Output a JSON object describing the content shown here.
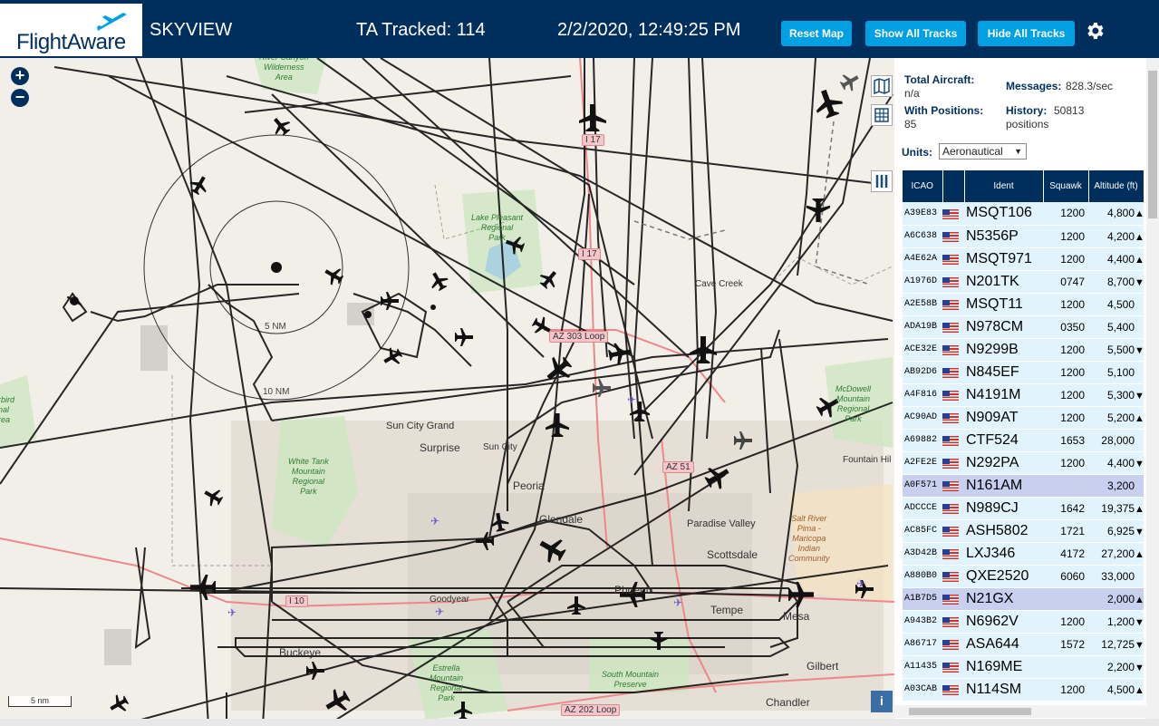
{
  "header": {
    "logo_text": "FlightAware",
    "site_name": "SKYVIEW",
    "tracked": "TA Tracked: 114",
    "datetime": "2/2/2020, 12:49:25 PM",
    "buttons": {
      "reset": "Reset Map",
      "show_all": "Show All Tracks",
      "hide_all": "Hide All Tracks"
    },
    "brand_color": "#002f5d",
    "button_color": "#00a0e2"
  },
  "map": {
    "zoom_in": "+",
    "zoom_out": "−",
    "scale_label": "5 nm",
    "ring_labels": [
      "5 NM",
      "10 NM"
    ],
    "info_icon": "i",
    "places": [
      "Cave Creek",
      "Sun City Grand",
      "Surprise",
      "Sun City",
      "Peoria",
      "Glendale",
      "Paradise Valley",
      "Scottsdale",
      "Phoenix",
      "Tempe",
      "Mesa",
      "Gilbert",
      "Chandler",
      "Goodyear",
      "Buckeye",
      "Fountain Hil"
    ],
    "parks": {
      "lake_pleasant": "Lake Pleasant\nRegional\nPark",
      "white_tank": "White Tank\nMountain\nRegional\nPark",
      "mcdowell": "McDowell\nMountain\nRegional\nPark",
      "estrella": "Estrella\nMountain\nRegional\nPark",
      "south_mountain": "South Mountain\nPreserve",
      "salt_river": "Salt River\nPima -\nMaricopa\nIndian\nCommunity",
      "wilderness": "River Canyon\nWilderness\nArea",
      "bird": "rbird\nnal\nrea"
    },
    "roads": [
      "I 17",
      "AZ 303 Loop",
      "I 10",
      "AZ 51",
      "AZ 202 Loop"
    ]
  },
  "sidebar": {
    "total_aircraft_label": "Total Aircraft:",
    "total_aircraft_value": "n/a",
    "with_positions_label": "With Positions:",
    "with_positions_value": "85",
    "messages_label": "Messages:",
    "messages_value": "828.3/sec",
    "history_label": "History:",
    "history_value": "50813",
    "history_unit": "positions",
    "units_label": "Units:",
    "units_value": "Aeronautical"
  },
  "table": {
    "headers": [
      "ICAO",
      "",
      "Ident",
      "Squawk",
      "Altitude (ft)"
    ],
    "rows": [
      {
        "icao": "A39E83",
        "ident": "MSQT106",
        "squawk": "1200",
        "alt": "4,800",
        "trend": "▲",
        "sel": false
      },
      {
        "icao": "A6C638",
        "ident": "N5356P",
        "squawk": "1200",
        "alt": "4,200",
        "trend": "▲",
        "sel": false
      },
      {
        "icao": "A4E62A",
        "ident": "MSQT971",
        "squawk": "1200",
        "alt": "4,400",
        "trend": "▲",
        "sel": false
      },
      {
        "icao": "A1976D",
        "ident": "N201TK",
        "squawk": "0747",
        "alt": "8,700",
        "trend": "▼",
        "sel": false
      },
      {
        "icao": "A2E58B",
        "ident": "MSQT11",
        "squawk": "1200",
        "alt": "4,500",
        "trend": "",
        "sel": false
      },
      {
        "icao": "ADA19B",
        "ident": "N978CM",
        "squawk": "0350",
        "alt": "5,400",
        "trend": "",
        "sel": false
      },
      {
        "icao": "ACE32E",
        "ident": "N9299B",
        "squawk": "1200",
        "alt": "5,500",
        "trend": "▼",
        "sel": false
      },
      {
        "icao": "AB92D6",
        "ident": "N845EF",
        "squawk": "1200",
        "alt": "5,100",
        "trend": "",
        "sel": false
      },
      {
        "icao": "A4F816",
        "ident": "N4191M",
        "squawk": "1200",
        "alt": "5,300",
        "trend": "▼",
        "sel": false
      },
      {
        "icao": "AC90AD",
        "ident": "N909AT",
        "squawk": "1200",
        "alt": "5,200",
        "trend": "▲",
        "sel": false
      },
      {
        "icao": "A69882",
        "ident": "CTF524",
        "squawk": "1653",
        "alt": "28,000",
        "trend": "",
        "sel": false
      },
      {
        "icao": "A2FE2E",
        "ident": "N292PA",
        "squawk": "1200",
        "alt": "4,400",
        "trend": "▼",
        "sel": false
      },
      {
        "icao": "A0F571",
        "ident": "N161AM",
        "squawk": "",
        "alt": "3,200",
        "trend": "",
        "sel": true
      },
      {
        "icao": "ADCCCE",
        "ident": "N989CJ",
        "squawk": "1642",
        "alt": "19,375",
        "trend": "▲",
        "sel": false
      },
      {
        "icao": "AC85FC",
        "ident": "ASH5802",
        "squawk": "1721",
        "alt": "6,925",
        "trend": "▼",
        "sel": false
      },
      {
        "icao": "A3D42B",
        "ident": "LXJ346",
        "squawk": "4172",
        "alt": "27,200",
        "trend": "▲",
        "sel": false
      },
      {
        "icao": "A880B0",
        "ident": "QXE2520",
        "squawk": "6060",
        "alt": "33,000",
        "trend": "",
        "sel": false
      },
      {
        "icao": "A1B7D5",
        "ident": "N21GX",
        "squawk": "",
        "alt": "2,000",
        "trend": "▲",
        "sel": true
      },
      {
        "icao": "A943B2",
        "ident": "N6962V",
        "squawk": "1200",
        "alt": "1,200",
        "trend": "▼",
        "sel": false
      },
      {
        "icao": "A86717",
        "ident": "ASA644",
        "squawk": "1572",
        "alt": "12,725",
        "trend": "▼",
        "sel": false
      },
      {
        "icao": "A11435",
        "ident": "N169ME",
        "squawk": "",
        "alt": "2,200",
        "trend": "▼",
        "sel": false
      },
      {
        "icao": "A03CAB",
        "ident": "N114SM",
        "squawk": "1200",
        "alt": "4,500",
        "trend": "▲",
        "sel": false
      }
    ]
  }
}
